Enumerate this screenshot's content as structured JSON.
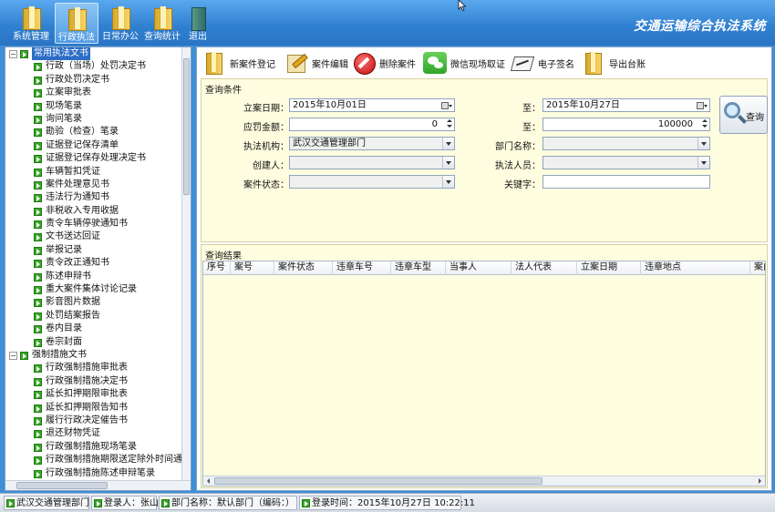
{
  "topbar": {
    "buttons": [
      {
        "label": "系统管理",
        "icon": "folder-icon"
      },
      {
        "label": "行政执法",
        "icon": "folder-icon"
      },
      {
        "label": "日常办公",
        "icon": "folder-icon"
      },
      {
        "label": "查询统计",
        "icon": "folder-icon"
      },
      {
        "label": "退出",
        "icon": "exit-door-icon"
      }
    ],
    "app_title": "交通运输综合执法系统"
  },
  "tree": {
    "groups": [
      {
        "label": "常用执法文书",
        "items": [
          "行政（当场）处罚决定书",
          "行政处罚决定书",
          "立案审批表",
          "现场笔录",
          "询问笔录",
          "勘验（检查）笔录",
          "证据登记保存清单",
          "证据登记保存处理决定书",
          "车辆暂扣凭证",
          "案件处理意见书",
          "违法行为通知书",
          "非税收入专用收据",
          "责令车辆停驶通知书",
          "文书送达回证",
          "举报记录",
          "责令改正通知书",
          "陈述申辩书",
          "重大案件集体讨论记录",
          "影音图片数据",
          "处罚结案报告",
          "卷内目录",
          "卷宗封面"
        ]
      },
      {
        "label": "强制措施文书",
        "items": [
          "行政强制措施审批表",
          "行政强制措施决定书",
          "延长扣押期限审批表",
          "延长扣押期限告知书",
          "履行行政决定催告书",
          "退还财物凭证",
          "行政强制措施现场笔录",
          "行政强制措施期限送定除外时间通知",
          "行政强制措施陈述申辩笔录"
        ]
      }
    ]
  },
  "toolbar": {
    "new_case": "新案件登记",
    "edit_case": "案件编辑",
    "delete_case": "删除案件",
    "wechat_evidence": "微信现场取证",
    "e_sign": "电子签名",
    "export": "导出台账"
  },
  "query": {
    "section_title": "查询条件",
    "labels": {
      "filing_date": "立案日期：",
      "to1": "至：",
      "penalty": "应罚金额：",
      "to2": "至：",
      "agency": "执法机构：",
      "department": "部门名称：",
      "creator": "创建人：",
      "officer": "执法人员：",
      "status": "案件状态：",
      "keyword": "关键字："
    },
    "values": {
      "date_from": "2015年10月01日",
      "date_to": "2015年10月27日",
      "amount_from": "0",
      "amount_to": "100000",
      "agency": "武汉交通管理部门",
      "department": "",
      "creator": "",
      "officer": "",
      "status": "",
      "keyword": ""
    },
    "button_label": "查询"
  },
  "results": {
    "section_title": "查询结果",
    "columns": [
      "序号",
      "案号",
      "案件状态",
      "违章车号",
      "违章车型",
      "当事人",
      "法人代表",
      "立案日期",
      "违章地点",
      "案由"
    ]
  },
  "status_bar": {
    "org": "武汉交通管理部门",
    "user": "登录人：张山",
    "dept": "部门名称：默认部门（编码：）",
    "login_time": "登录时间：2015年10月27日 10:22:11"
  }
}
